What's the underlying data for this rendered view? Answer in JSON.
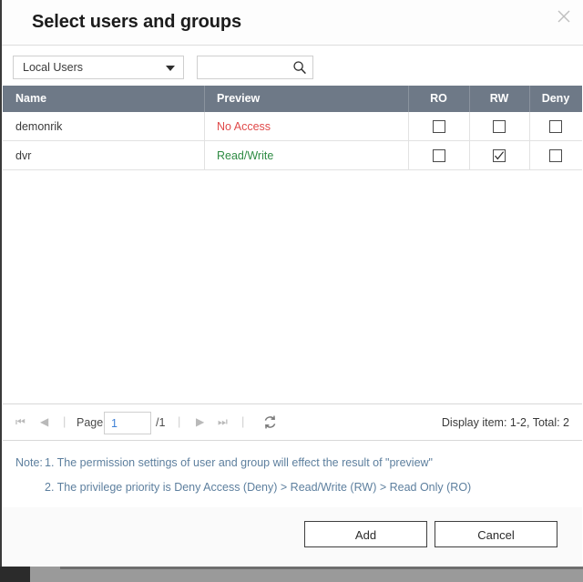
{
  "dialog": {
    "title": "Select users and groups",
    "close_icon": "close-icon"
  },
  "toolbar": {
    "source_select": {
      "selected": "Local Users",
      "options": [
        "Local Users"
      ],
      "caret_icon": "chevron-down-icon"
    },
    "search": {
      "value": "",
      "placeholder": "",
      "icon": "search-icon"
    }
  },
  "table": {
    "columns": [
      "Name",
      "Preview",
      "RO",
      "RW",
      "Deny"
    ],
    "rows": [
      {
        "name": "demonrik",
        "preview": "No Access",
        "preview_color": "#e04a4a",
        "ro": false,
        "rw": false,
        "deny": false
      },
      {
        "name": "dvr",
        "preview": "Read/Write",
        "preview_color": "#2e8b43",
        "ro": false,
        "rw": true,
        "deny": false
      }
    ]
  },
  "pager": {
    "first_icon": "first-page-icon",
    "prev_icon": "previous-page-icon",
    "page_label": "Page",
    "page_value": "1",
    "page_total": "/1",
    "next_icon": "next-page-icon",
    "last_icon": "last-page-icon",
    "refresh_icon": "refresh-icon",
    "display_count": "Display item: 1-2, Total: 2"
  },
  "note": {
    "label": "Note:",
    "line1": "1. The permission settings of user and group will effect the result of \"preview\"",
    "line2": "2. The privilege priority is Deny Access (Deny) > Read/Write (RW) > Read Only (RO)",
    "color": "#5d7f9e"
  },
  "footer": {
    "add_label": "Add",
    "cancel_label": "Cancel"
  },
  "colors": {
    "header_bar": "#6e7987",
    "accent_blue": "#3d7fd6",
    "note_blue": "#5d7f9e",
    "deny_red": "#e04a4a",
    "rw_green": "#2e8b43"
  }
}
